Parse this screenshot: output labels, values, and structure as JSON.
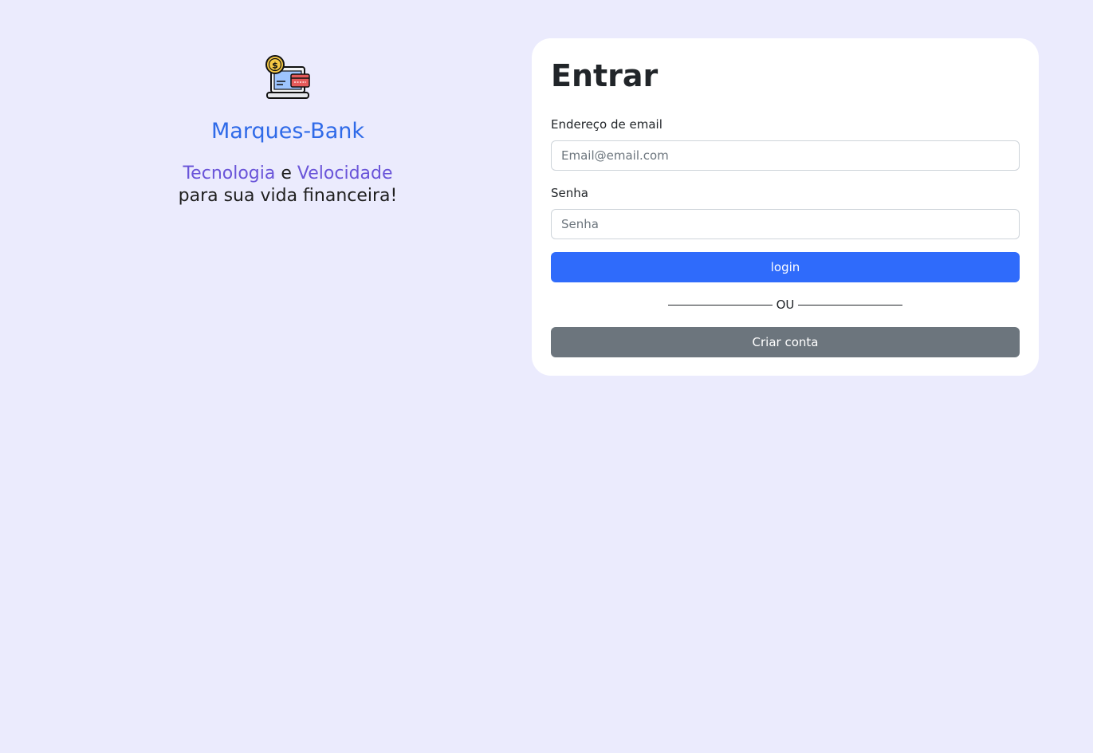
{
  "brand": {
    "name": "Marques-Bank",
    "tagline_word1": "Tecnologia",
    "tagline_conj": "e",
    "tagline_word2": "Velocidade",
    "tagline_line2": "para sua vida financeira!",
    "logo_icon": "laptop-payment-icon"
  },
  "login": {
    "title": "Entrar",
    "email_label": "Endereço de email",
    "email_placeholder": "Email@email.com",
    "email_value": "",
    "password_label": "Senha",
    "password_placeholder": "Senha",
    "password_value": "",
    "login_button": "login",
    "divider_text": "OU",
    "create_account_button": "Criar conta"
  },
  "colors": {
    "background": "#ebebfd",
    "brand_blue": "#2f6ae8",
    "accent_purple": "#6a55d9",
    "primary_button": "#2f6bfb",
    "secondary_button": "#6c757d"
  }
}
